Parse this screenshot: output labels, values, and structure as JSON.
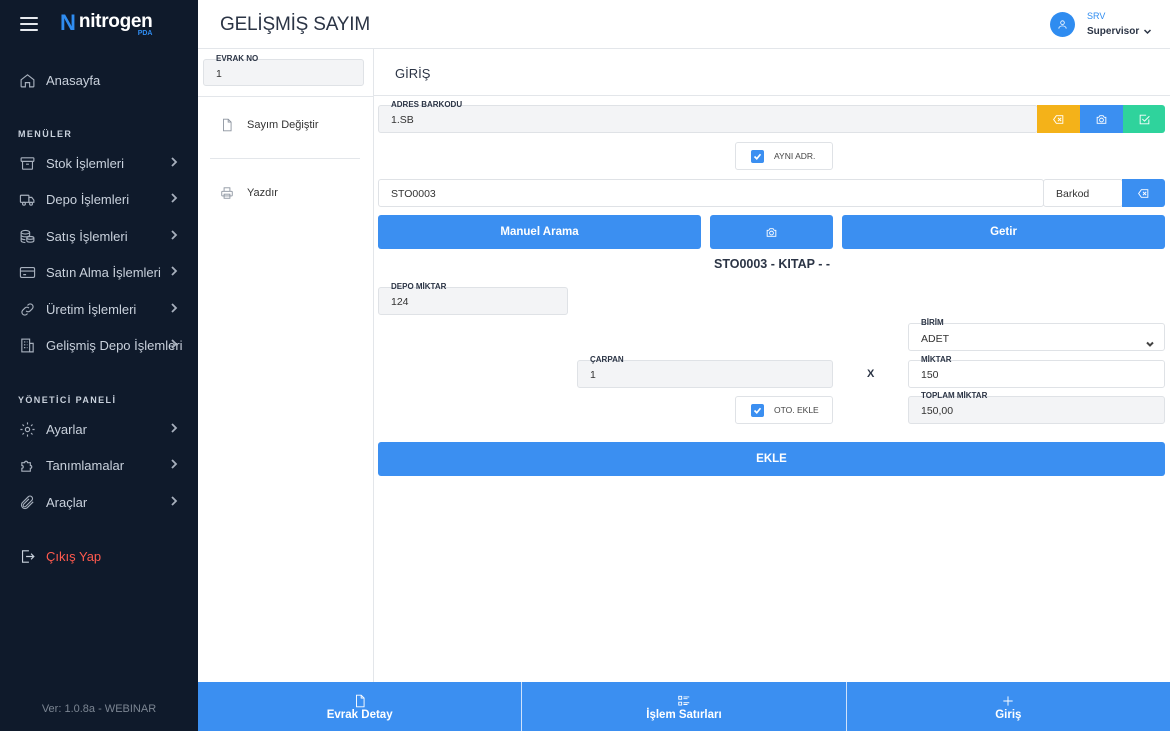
{
  "app": {
    "logo_name": "nitrogen",
    "logo_sub": "PDA",
    "version": "Ver: 1.0.8a - WEBINAR"
  },
  "header": {
    "title": "GELİŞMİŞ SAYIM",
    "user_code": "SRV",
    "user_role": "Supervisor"
  },
  "sidebar": {
    "home": "Anasayfa",
    "menus_heading": "MENÜLER",
    "menus": [
      {
        "label": "Stok İşlemleri"
      },
      {
        "label": "Depo İşlemleri"
      },
      {
        "label": "Satış İşlemleri"
      },
      {
        "label": "Satın Alma İşlemleri"
      },
      {
        "label": "Üretim İşlemleri"
      },
      {
        "label": "Gelişmiş Depo İşlemleri"
      }
    ],
    "admin_heading": "YÖNETİCİ PANELİ",
    "admin": [
      {
        "label": "Ayarlar"
      },
      {
        "label": "Tanımlamalar"
      },
      {
        "label": "Araçlar"
      }
    ],
    "logout": "Çıkış Yap"
  },
  "subpanel": {
    "evrak_label": "EVRAK NO",
    "evrak_value": "1",
    "menu": [
      {
        "label": "Sayım Değiştir"
      },
      {
        "label": "Yazdır"
      }
    ]
  },
  "content": {
    "title": "GİRİŞ",
    "adres_label": "ADRES BARKODU",
    "adres_value": "1.SB",
    "ayni_adr": "AYNI ADR.",
    "barcode_value": "STO0003",
    "barcode_type": "Barkod",
    "manual_search": "Manuel Arama",
    "getir": "Getir",
    "product_title": "STO0003 - KITAP - -",
    "depo_label": "DEPO MİKTAR",
    "depo_value": "124",
    "birim_label": "BİRİM",
    "birim_value": "ADET",
    "carpan_label": "ÇARPAN",
    "carpan_value": "1",
    "x": "X",
    "miktar_label": "MİKTAR",
    "miktar_value": "150",
    "oto_ekle": "OTO. EKLE",
    "toplam_label": "TOPLAM MİKTAR",
    "toplam_value": "150,00",
    "ekle": "EKLE"
  },
  "bottom_nav": [
    {
      "label": "Evrak Detay",
      "icon": "document-icon"
    },
    {
      "label": "İşlem Satırları",
      "icon": "list-icon"
    },
    {
      "label": "Giriş",
      "icon": "plus-icon"
    }
  ],
  "colors": {
    "sidebar_bg": "#0f1a2b",
    "primary": "#3b8ff1",
    "warning": "#f4b219",
    "success": "#2fd39c",
    "logout": "#ff5a4e"
  }
}
